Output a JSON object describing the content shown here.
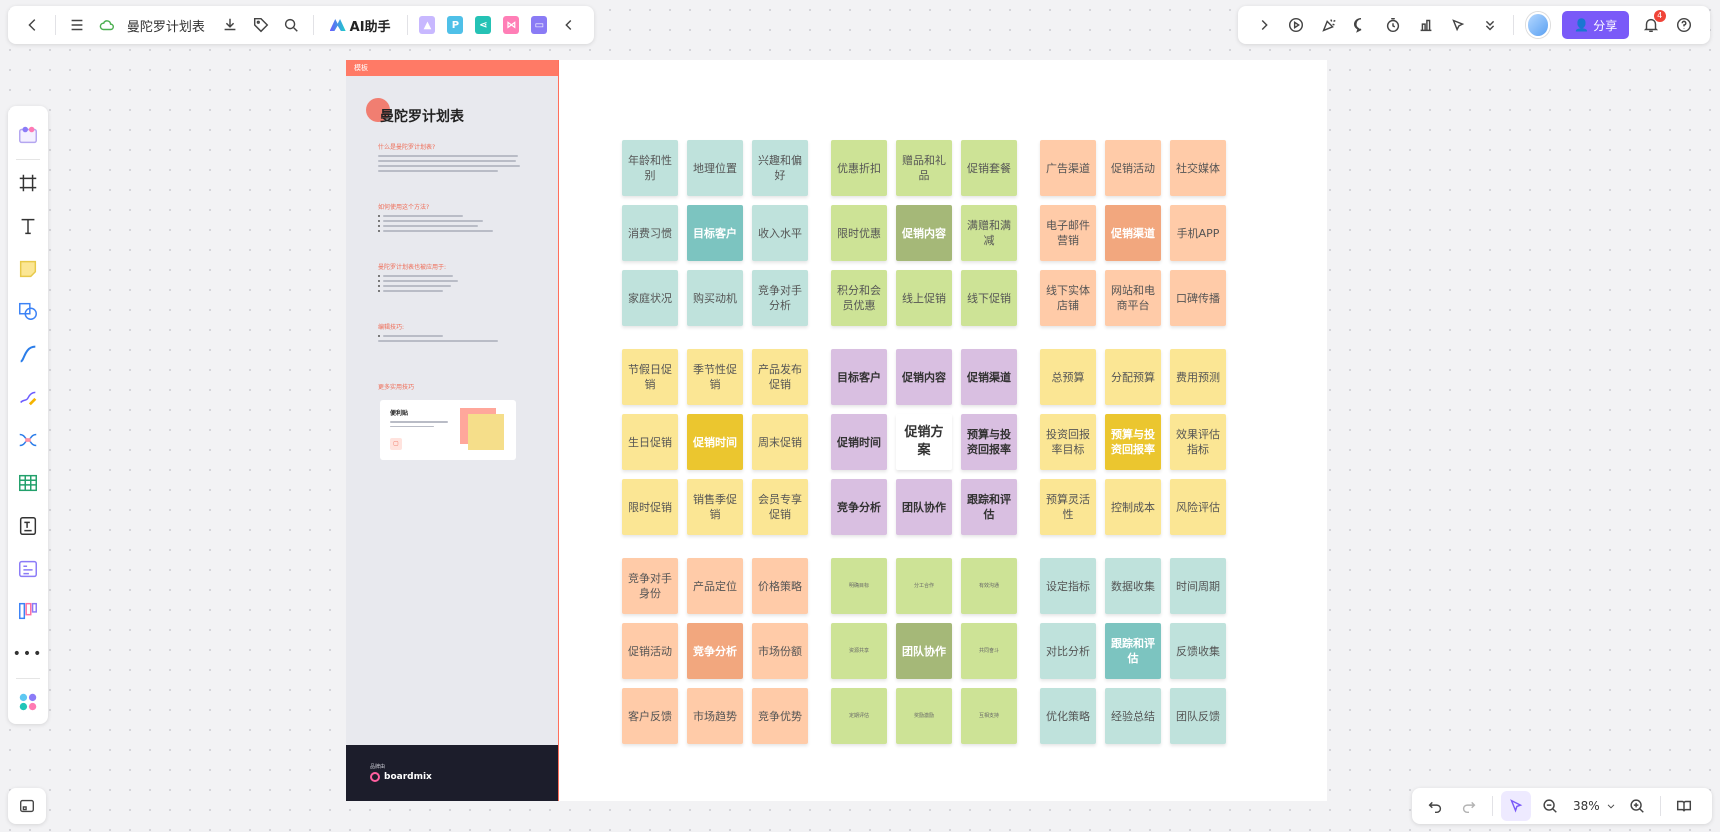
{
  "header": {
    "doc_title": "曼陀罗计划表",
    "ai_label": "AI助手",
    "share_label": "分享",
    "notification_count": "4"
  },
  "zoom": {
    "level": "38%"
  },
  "guide": {
    "tag": "模板",
    "title": "曼陀罗计划表",
    "sections": [
      "什么是曼陀罗计划表?",
      "如何使用这个方法?",
      "曼陀罗计划表也被应用于:",
      "编辑技巧:",
      "更多实用技巧"
    ],
    "card_title": "便利贴",
    "footer_small": "品牌由",
    "footer_brand": "boardmix"
  },
  "colors": {
    "teal": "#bfe2dc",
    "teal_dark": "#7cc4c0",
    "green": "#cde396",
    "green_dark": "#a5b878",
    "peach": "#ffcba8",
    "peach_dark": "#f2a77e",
    "yellow": "#fbe694",
    "yellow_dark": "#ebc62f",
    "purple": "#d9bfe1",
    "white": "#ffffff",
    "accent": "#7a5af8",
    "guide_accent": "#ff7a66"
  },
  "mandala": {
    "blocks": [
      {
        "color": "teal",
        "hl_color": "teal_dark",
        "center": 4,
        "notes": [
          "年龄和性别",
          "地理位置",
          "兴趣和偏好",
          "消费习惯",
          "目标客户",
          "收入水平",
          "家庭状况",
          "购买动机",
          "竞争对手分析"
        ]
      },
      {
        "color": "green",
        "hl_color": "green_dark",
        "center": 4,
        "notes": [
          "优惠折扣",
          "赠品和礼品",
          "促销套餐",
          "限时优惠",
          "促销内容",
          "满赠和满减",
          "积分和会员优惠",
          "线上促销",
          "线下促销"
        ]
      },
      {
        "color": "peach",
        "hl_color": "peach_dark",
        "center": 4,
        "notes": [
          "广告渠道",
          "促销活动",
          "社交媒体",
          "电子邮件营销",
          "促销渠道",
          "手机APP",
          "线下实体店铺",
          "网站和电商平台",
          "口碑传播"
        ]
      },
      {
        "color": "yellow",
        "hl_color": "yellow_dark",
        "center": 4,
        "notes": [
          "节假日促销",
          "季节性促销",
          "产品发布促销",
          "生日促销",
          "促销时间",
          "周末促销",
          "限时促销",
          "销售季促销",
          "会员专享促销"
        ]
      },
      {
        "color": "purple",
        "hl_color": "white",
        "center": 4,
        "bold": true,
        "notes": [
          "目标客户",
          "促销内容",
          "促销渠道",
          "促销时间",
          "促销方案",
          "预算与投资回报率",
          "竞争分析",
          "团队协作",
          "跟踪和评估"
        ]
      },
      {
        "color": "yellow",
        "hl_color": "yellow_dark",
        "center": 4,
        "notes": [
          "总预算",
          "分配预算",
          "费用预测",
          "投资回报率目标",
          "预算与投资回报率",
          "效果评估指标",
          "预算灵活性",
          "控制成本",
          "风险评估"
        ]
      },
      {
        "color": "peach",
        "hl_color": "peach_dark",
        "center": 4,
        "notes": [
          "竞争对手身份",
          "产品定位",
          "价格策略",
          "促销活动",
          "竞争分析",
          "市场份额",
          "客户反馈",
          "市场趋势",
          "竞争优势"
        ]
      },
      {
        "color": "green",
        "hl_color": "green_dark",
        "center": 4,
        "tiny": true,
        "notes": [
          "明确目标",
          "分工合作",
          "有效沟通",
          "资源共享",
          "团队协作",
          "共同奋斗",
          "定期评估",
          "奖励激励",
          "互相支持"
        ]
      },
      {
        "color": "teal",
        "hl_color": "teal_dark",
        "center": 4,
        "notes": [
          "设定指标",
          "数据收集",
          "时间周期",
          "对比分析",
          "跟踪和评估",
          "反馈收集",
          "优化策略",
          "经验总结",
          "团队反馈"
        ]
      }
    ]
  }
}
